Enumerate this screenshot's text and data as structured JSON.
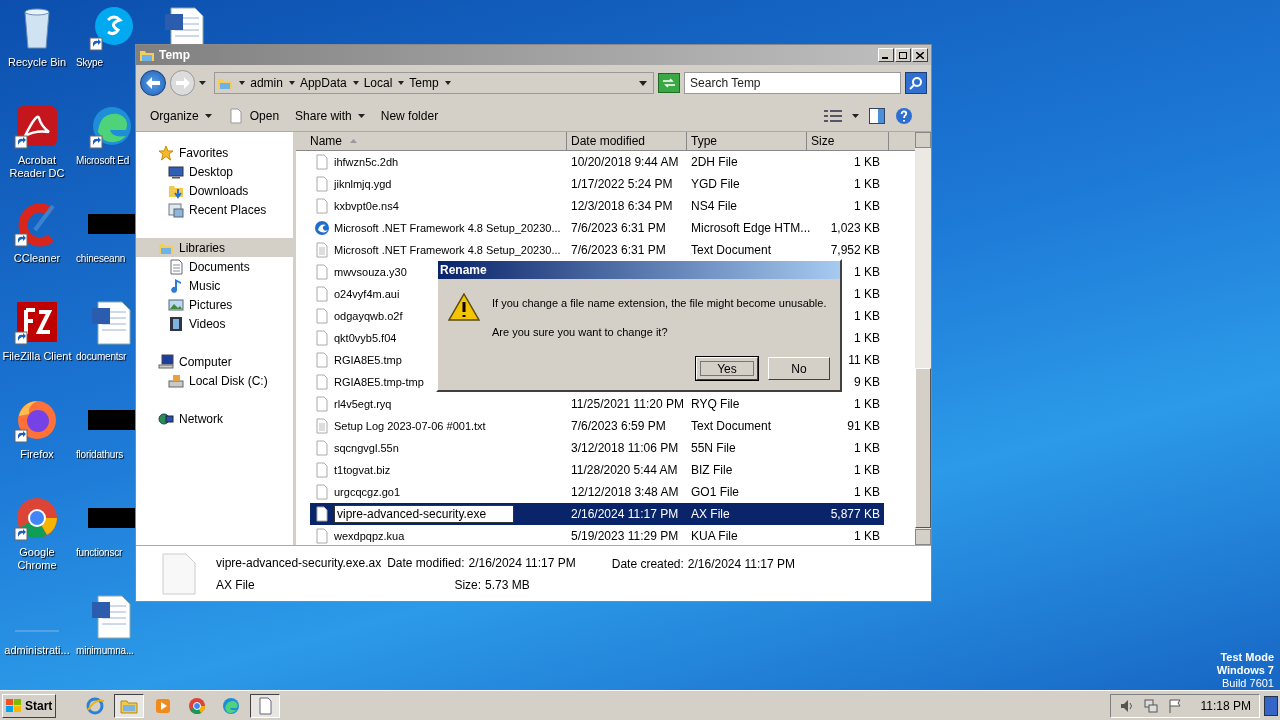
{
  "desktop": {
    "columns": [
      [
        {
          "label": "Recycle Bin",
          "kind": "recycle",
          "shortcut": false
        },
        {
          "label": "Acrobat Reader DC",
          "kind": "acrobat",
          "shortcut": true
        },
        {
          "label": "CCleaner",
          "kind": "ccleaner",
          "shortcut": true
        },
        {
          "label": "FileZilla Client",
          "kind": "filezilla",
          "shortcut": true
        },
        {
          "label": "Firefox",
          "kind": "firefox",
          "shortcut": true
        },
        {
          "label": "Google Chrome",
          "kind": "chrome",
          "shortcut": true
        },
        {
          "label": "administrati...",
          "kind": "blank",
          "shortcut": false
        }
      ],
      [
        {
          "label": "Skype",
          "kind": "skype",
          "shortcut": true
        },
        {
          "label": "Microsoft Ed",
          "kind": "edge",
          "shortcut": true
        },
        {
          "label": "chineseann",
          "kind": "redacted",
          "shortcut": false
        },
        {
          "label": "documentsr",
          "kind": "word",
          "shortcut": false
        },
        {
          "label": "floridathurs",
          "kind": "redacted",
          "shortcut": false
        },
        {
          "label": "functionscr",
          "kind": "redacted",
          "shortcut": false
        },
        {
          "label": "minimumna...",
          "kind": "word",
          "shortcut": false
        }
      ],
      [
        {
          "kind": "word",
          "shortcut": false
        }
      ]
    ]
  },
  "watermark_system": [
    "Test Mode",
    "Windows 7",
    "Build 7601"
  ],
  "window": {
    "title": "Temp",
    "breadcrumbs": [
      "admin",
      "AppData",
      "Local",
      "Temp"
    ],
    "search": {
      "placeholder": "Search Temp"
    },
    "toolbar": [
      {
        "label": "Organize",
        "dropdown": true,
        "kind": "plain"
      },
      {
        "label": "Open",
        "dropdown": false,
        "kind": "page"
      },
      {
        "label": "Share with",
        "dropdown": true,
        "kind": "plain"
      },
      {
        "label": "New folder",
        "dropdown": false,
        "kind": "plain"
      }
    ],
    "nav": [
      {
        "label": "Favorites",
        "kind": "star",
        "selected": false,
        "children": [
          {
            "label": "Desktop",
            "kind": "desktop",
            "selected": false
          },
          {
            "label": "Downloads",
            "kind": "downloads",
            "selected": false
          },
          {
            "label": "Recent Places",
            "kind": "recent",
            "selected": false
          }
        ]
      },
      {
        "label": "Libraries",
        "kind": "library",
        "selected": true,
        "children": [
          {
            "label": "Documents",
            "kind": "documents",
            "selected": false
          },
          {
            "label": "Music",
            "kind": "music",
            "selected": false
          },
          {
            "label": "Pictures",
            "kind": "pictures",
            "selected": false
          },
          {
            "label": "Videos",
            "kind": "videos",
            "selected": false
          }
        ]
      },
      {
        "label": "Computer",
        "kind": "computer",
        "selected": false,
        "children": [
          {
            "label": "Local Disk (C:)",
            "kind": "disk",
            "selected": false
          }
        ]
      },
      {
        "label": "Network",
        "kind": "network",
        "selected": false
      }
    ],
    "columns": [
      "Name",
      "Date modified",
      "Type",
      "Size"
    ],
    "rows": [
      {
        "name": "ihfwzn5c.2dh",
        "date": "10/20/2018 9:44 AM",
        "type": "2DH File",
        "size": "1 KB",
        "kind": "file",
        "selected": false,
        "editing": false
      },
      {
        "name": "jiknlmjq.ygd",
        "date": "1/17/2022 5:24 PM",
        "type": "YGD File",
        "size": "1 KB",
        "kind": "file",
        "selected": false,
        "editing": false
      },
      {
        "name": "kxbvpt0e.ns4",
        "date": "12/3/2018 6:34 PM",
        "type": "NS4 File",
        "size": "1 KB",
        "kind": "file",
        "selected": false,
        "editing": false
      },
      {
        "name": "Microsoft .NET Framework 4.8 Setup_20230...",
        "date": "7/6/2023 6:31 PM",
        "type": "Microsoft Edge HTM...",
        "size": "1,023 KB",
        "kind": "edge",
        "selected": false,
        "editing": false
      },
      {
        "name": "Microsoft .NET Framework 4.8 Setup_20230...",
        "date": "7/6/2023 6:31 PM",
        "type": "Text Document",
        "size": "7,952 KB",
        "kind": "text",
        "selected": false,
        "editing": false
      },
      {
        "name": "mwvsouza.y30",
        "size": "1 KB",
        "kind": "file",
        "selected": false,
        "editing": false
      },
      {
        "name": "o24vyf4m.aui",
        "size": "1 KB",
        "kind": "file",
        "selected": false,
        "editing": false
      },
      {
        "name": "odgayqwb.o2f",
        "size": "1 KB",
        "kind": "file",
        "selected": false,
        "editing": false
      },
      {
        "name": "qkt0vyb5.f04",
        "size": "1 KB",
        "kind": "file",
        "selected": false,
        "editing": false
      },
      {
        "name": "RGIA8E5.tmp",
        "size": "11 KB",
        "kind": "file",
        "selected": false,
        "editing": false
      },
      {
        "name": "RGIA8E5.tmp-tmp",
        "size": "9 KB",
        "kind": "file",
        "selected": false,
        "editing": false
      },
      {
        "name": "rl4v5egt.ryq",
        "date": "11/25/2021 11:20 PM",
        "type": "RYQ File",
        "size": "1 KB",
        "kind": "file",
        "selected": false,
        "editing": false
      },
      {
        "name": "Setup Log 2023-07-06 #001.txt",
        "date": "7/6/2023 6:59 PM",
        "type": "Text Document",
        "size": "91 KB",
        "kind": "text",
        "selected": false,
        "editing": false
      },
      {
        "name": "sqcngvgl.55n",
        "date": "3/12/2018 11:06 PM",
        "type": "55N File",
        "size": "1 KB",
        "kind": "file",
        "selected": false,
        "editing": false
      },
      {
        "name": "t1togvat.biz",
        "date": "11/28/2020 5:44 AM",
        "type": "BIZ File",
        "size": "1 KB",
        "kind": "file",
        "selected": false,
        "editing": false
      },
      {
        "name": "urgcqcgz.go1",
        "date": "12/12/2018 3:48 AM",
        "type": "GO1 File",
        "size": "1 KB",
        "kind": "file",
        "selected": false,
        "editing": false
      },
      {
        "name": "vipre-advanced-security.exe",
        "date": "2/16/2024 11:17 PM",
        "type": "AX File",
        "size": "5,877 KB",
        "kind": "file",
        "selected": true,
        "editing": true
      },
      {
        "name": "wexdpqpz.kua",
        "date": "5/19/2023 11:29 PM",
        "type": "KUA File",
        "size": "1 KB",
        "kind": "file",
        "selected": false,
        "editing": false
      }
    ],
    "details": {
      "name": "vipre-advanced-security.exe.ax",
      "type": "AX File",
      "modified_label": "Date modified:",
      "modified": "2/16/2024 11:17 PM",
      "created_label": "Date created:",
      "created": "2/16/2024 11:17 PM",
      "size_label": "Size:",
      "size": "5.73 MB"
    }
  },
  "dialog": {
    "title": "Rename",
    "message": "If you change a file name extension, the file might become unusable.",
    "question": "Are you sure you want to change it?",
    "buttons": [
      {
        "label": "Yes",
        "default": true
      },
      {
        "label": "No",
        "default": false
      }
    ]
  },
  "taskbar": {
    "start": "Start",
    "apps": [
      {
        "kind": "ie",
        "open": false
      },
      {
        "kind": "explorer",
        "open": true
      },
      {
        "kind": "media",
        "open": false
      },
      {
        "kind": "chrome",
        "open": false
      },
      {
        "kind": "edge",
        "open": false
      },
      {
        "kind": "notepad",
        "open": true
      }
    ],
    "clock": "11:18 PM"
  }
}
